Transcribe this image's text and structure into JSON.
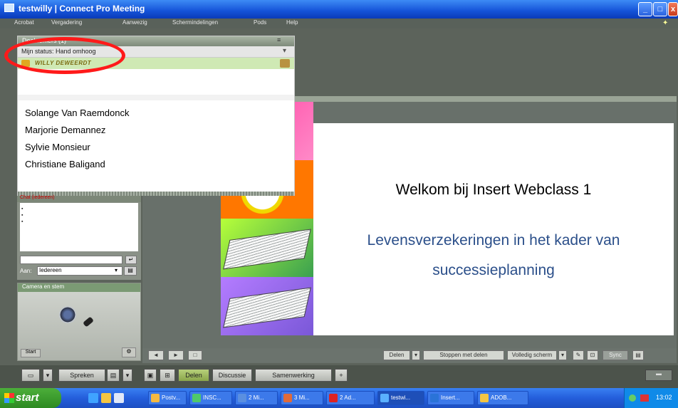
{
  "window": {
    "title": "testwilly  |  Connect Pro Meeting",
    "min": "_",
    "max": "□",
    "close": "x"
  },
  "menu": [
    "Acrobat",
    "Vergadering",
    "Aanwezig",
    "Schermindelingen",
    "Pods",
    "Help"
  ],
  "people_pod": {
    "title": "Deelnemers (1)",
    "status_label": "Mijn status: Hand omhoog",
    "host": "WILLY DEWEERDT",
    "participants": [
      "Solange Van Raemdonck",
      "Marjorie Demannez",
      "Sylvie Monsieur",
      "Christiane Baligand"
    ]
  },
  "chat_pod": {
    "title": "Chat (iedereen)",
    "to_label": "Aan:",
    "to_value": "Iedereen",
    "send": "↵"
  },
  "camera_pod": {
    "title": "Camera en stem",
    "start": "Start",
    "options": "⚙"
  },
  "slide": {
    "title": "Welkom bij Insert Webclass 1",
    "subtitle": "Levensverzekeringen in het kader van successieplanning"
  },
  "share_toolbar": {
    "share": "Delen",
    "stop": "Stoppen met delen",
    "fullscreen": "Volledig scherm",
    "sync": "Sync"
  },
  "bottom_bar": {
    "speak": "Spreken",
    "share": "Delen",
    "discussion": "Discussie",
    "collab": "Samenwerking"
  },
  "taskbar": {
    "start": "start",
    "tasks": [
      "Postv...",
      "INSC...",
      "2 Mi...",
      "3 Mi...",
      "2 Ad...",
      "testwi...",
      "Insert...",
      "ADOB..."
    ],
    "clock": "13:02"
  }
}
